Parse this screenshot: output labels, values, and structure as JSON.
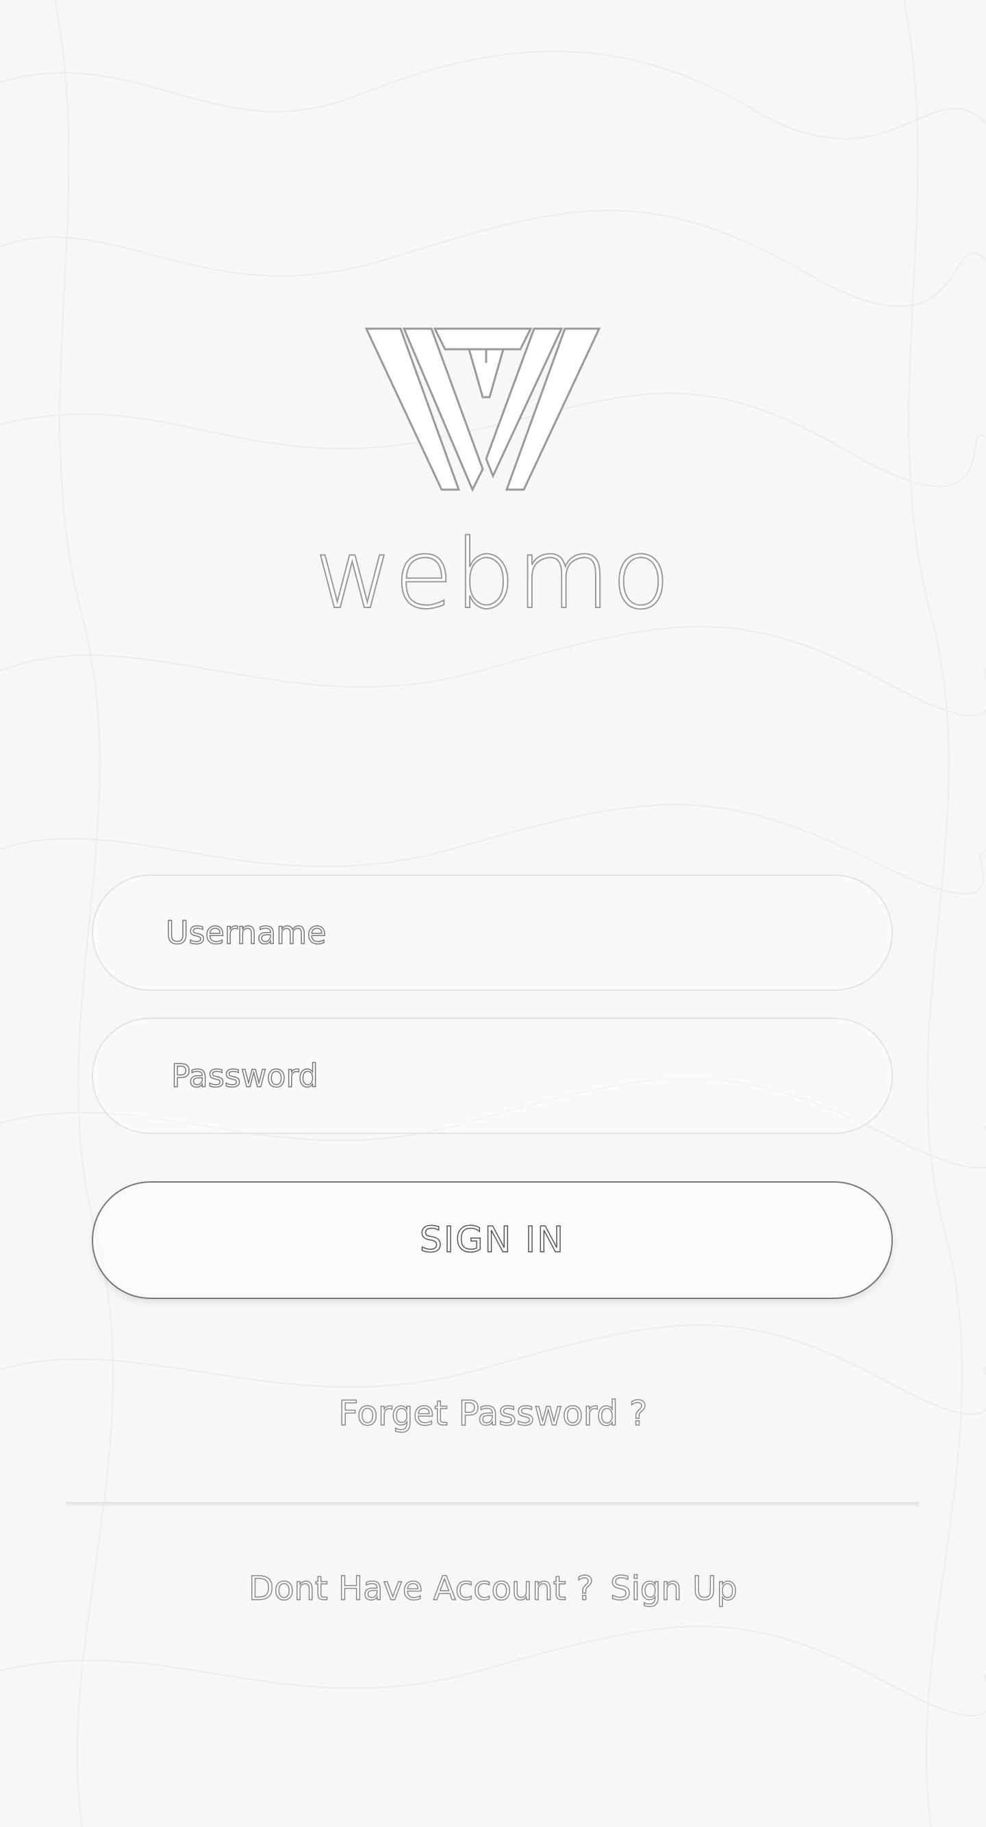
{
  "app": {
    "brand_name": "webmo"
  },
  "login_form": {
    "username_placeholder": "Username",
    "password_placeholder": "Password",
    "sign_in_label": "SIGN IN",
    "forgot_password_label": "Forget Password ?",
    "no_account_text": "Dont Have Account ?",
    "sign_up_label": "Sign Up"
  },
  "icons": {
    "logo": "webmo-w-logo-icon"
  },
  "colors": {
    "background": "#f7f7f7",
    "outline": "#888888",
    "field_border": "#e3e3e3",
    "button_border": "#777777"
  }
}
